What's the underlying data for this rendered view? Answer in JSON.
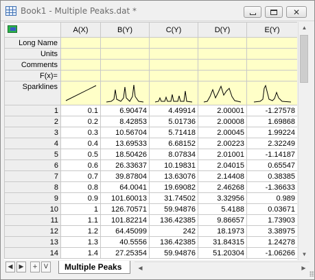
{
  "window": {
    "title": "Book1 - Multiple Peaks.dat *",
    "icon": "worksheet-icon"
  },
  "columns": [
    "A(X)",
    "B(Y)",
    "C(Y)",
    "D(Y)",
    "E(Y)"
  ],
  "meta_rows": [
    "Long Name",
    "Units",
    "Comments",
    "F(x)=",
    "Sparklines"
  ],
  "rows": [
    [
      "1",
      "0.1",
      "6.90474",
      "4.49914",
      "2.00001",
      "-1.27578"
    ],
    [
      "2",
      "0.2",
      "8.42853",
      "5.01736",
      "2.00008",
      "1.69868"
    ],
    [
      "3",
      "0.3",
      "10.56704",
      "5.71418",
      "2.00045",
      "1.99224"
    ],
    [
      "4",
      "0.4",
      "13.69533",
      "6.68152",
      "2.00223",
      "2.32249"
    ],
    [
      "5",
      "0.5",
      "18.50426",
      "8.07834",
      "2.01001",
      "-1.14187"
    ],
    [
      "6",
      "0.6",
      "26.33637",
      "10.19831",
      "2.04015",
      "0.65547"
    ],
    [
      "7",
      "0.7",
      "39.87804",
      "13.63076",
      "2.14408",
      "0.38385"
    ],
    [
      "8",
      "0.8",
      "64.0041",
      "19.69082",
      "2.46268",
      "-1.36633"
    ],
    [
      "9",
      "0.9",
      "101.60013",
      "31.74502",
      "3.32956",
      "0.989"
    ],
    [
      "10",
      "1",
      "126.70571",
      "59.94876",
      "5.4188",
      "0.03671"
    ],
    [
      "11",
      "1.1",
      "101.82214",
      "136.42385",
      "9.86657",
      "1.73903"
    ],
    [
      "12",
      "1.2",
      "64.45099",
      "242",
      "18.1973",
      "3.38975"
    ],
    [
      "13",
      "1.3",
      "40.5556",
      "136.42385",
      "31.84315",
      "1.24278"
    ],
    [
      "14",
      "1.4",
      "27.25354",
      "59.94876",
      "51.20304",
      "-1.06266"
    ]
  ],
  "sheet_tab": "Multiple Peaks",
  "nav_buttons": [
    "◀",
    "▶",
    "+",
    "V"
  ],
  "colors": {
    "meta_bg": "#ffffc8",
    "header_bg": "#eeeeee",
    "grid_line": "#c8c8c8"
  }
}
